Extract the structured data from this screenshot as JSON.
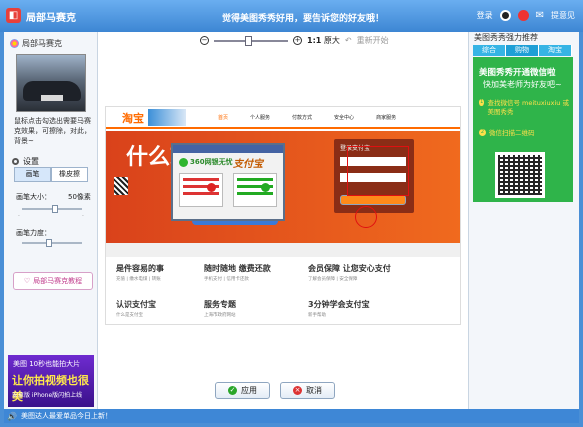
{
  "window": {
    "app_title": "局部马赛克",
    "promo_text": "觉得美图秀秀好用，要告诉您的好友哦！",
    "login_label": "登录",
    "feedback_label": "提意见",
    "brand_color": "#3d86d3"
  },
  "left_panel": {
    "header": "局部马赛克",
    "hint": "鼠标点击勾选出需要马赛克效果，可擦除，对此，背景~",
    "settings_title": "设置",
    "tabs": [
      "画笔",
      "橡皮擦"
    ],
    "brush_size_label": "画笔大小：",
    "brush_size_value": "50像素",
    "brush_strength_label": "画笔力度：",
    "tutorial_label": "局部马赛克教程",
    "ad_line1": "美图 10秒也能拍大片",
    "ad_line2": "让你拍视频也很美",
    "ad_line3": "安卓版 iPhone版闪拍上线",
    "brush_size_level": 0.55,
    "brush_strength_level": 0.45
  },
  "toolbar": {
    "zoom_level": 0.45,
    "actual_size": "1:1",
    "actual_size_label": "原大",
    "reset_label": "重新开始"
  },
  "canvas": {
    "site_logo": "淘宝",
    "nav_items": [
      "首页",
      "个人服务",
      "付款方式",
      "安全中心",
      "商家服务"
    ],
    "hero_headline": "什么就有什么",
    "badge_360": "360网银无忧",
    "login_title": "登录支付宝",
    "features": [
      {
        "title": "是件容易的事",
        "sub": "充值 | 缴水电煤 | 转账"
      },
      {
        "title": "随时随地 缴费还款",
        "sub": "手机支付 | 信用卡还款"
      },
      {
        "title": "会员保障 让您安心支付",
        "sub": "了解会员保障 | 安全保障"
      },
      {
        "title": "认识支付宝",
        "sub": "什么是支付宝"
      },
      {
        "title": "服务专题",
        "sub": "上海市政府网站"
      },
      {
        "title": "3分钟学会支付宝",
        "sub": "新手帮助"
      }
    ]
  },
  "buttons": {
    "apply": "应用",
    "cancel": "取消"
  },
  "right_panel": {
    "header": "美图秀秀强力推荐",
    "tabs": [
      "综合",
      "购物",
      "淘宝"
    ],
    "title_line1": "美图秀秀开通微信啦",
    "title_line2": "快加美老师为好友吧~",
    "steps": [
      "查找微信号 meituxiuxiu 或 美图秀秀",
      "微信扫描二维码"
    ]
  },
  "status": {
    "text": "美图达人最爱单品今日上新！"
  }
}
